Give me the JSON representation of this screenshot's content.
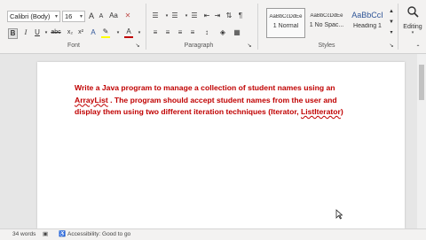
{
  "font": {
    "name_value": "Calibri (Body)",
    "size_value": "16",
    "group_label": "Font",
    "grow_label": "A",
    "shrink_label": "A",
    "case_label": "Aa",
    "bold_label": "B",
    "italic_label": "I",
    "underline_label": "U",
    "strike_label": "abc",
    "sub_label": "x₂",
    "sup_label": "x²",
    "effects_label": "A",
    "highlight_label": "✎",
    "color_label": "A"
  },
  "paragraph": {
    "group_label": "Paragraph",
    "pilcrow": "¶"
  },
  "styles": {
    "group_label": "Styles",
    "items": [
      {
        "preview": "AaBbCcDdEe",
        "name": "1 Normal"
      },
      {
        "preview": "AaBbCcDdEe",
        "name": "1 No Spac..."
      },
      {
        "preview": "AaBbCcI",
        "name": "Heading 1"
      }
    ]
  },
  "editing": {
    "label": "Editing",
    "icon": "magnifier-icon"
  },
  "document": {
    "line1": "Write a Java program to manage a collection of student names using an",
    "line2_a": "ArrayList",
    "line2_b": " . The program should accept student names from the user and",
    "line3_a": "display them using two different iteration techniques (Iterator, ",
    "line3_b": "ListIterator",
    "line3_c": ")"
  },
  "statusbar": {
    "words": "34 words",
    "accessibility": "Accessibility: Good to go"
  },
  "colors": {
    "doc_text": "#c00000",
    "font_color_bar": "#c00000",
    "highlight_bar": "#ffff00"
  }
}
